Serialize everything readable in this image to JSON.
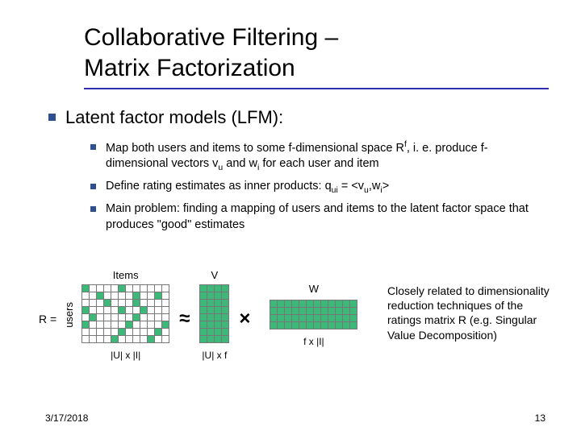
{
  "title_line1": "Collaborative Filtering –",
  "title_line2": "Matrix Factorization",
  "lvl1_text": "Latent factor models (LFM):",
  "sub1_a": "Map both users and items to some f-dimensional space R",
  "sub1_b": ", i. e. produce f-dimensional vectors v",
  "sub1_c": " and w",
  "sub1_d": " for each user and item",
  "sup_f": "f",
  "sub_u": "u",
  "sub_i": "i",
  "sub2_a": "Define rating estimates as inner products: q",
  "sub2_b": " = <v",
  "sub2_c": ",w",
  "sub2_d": ">",
  "sub_ui": "ui",
  "sub3": "Main problem: finding a mapping of users and items to the latent factor space that produces \"good\" estimates",
  "diagram": {
    "r_eq": "R =",
    "users_lbl": "users",
    "items_lbl": "Items",
    "v_lbl": "V",
    "w_lbl": "W",
    "dim_r": "|U| x |I|",
    "dim_v": "|U| x f",
    "dim_w": "f x |I|",
    "approx": "≈",
    "times": "×"
  },
  "closing_text": "Closely related to dimensionality reduction techniques of the ratings matrix R (e.g. Singular Value Decomposition)",
  "footer_date": "3/17/2018",
  "footer_page": "13"
}
